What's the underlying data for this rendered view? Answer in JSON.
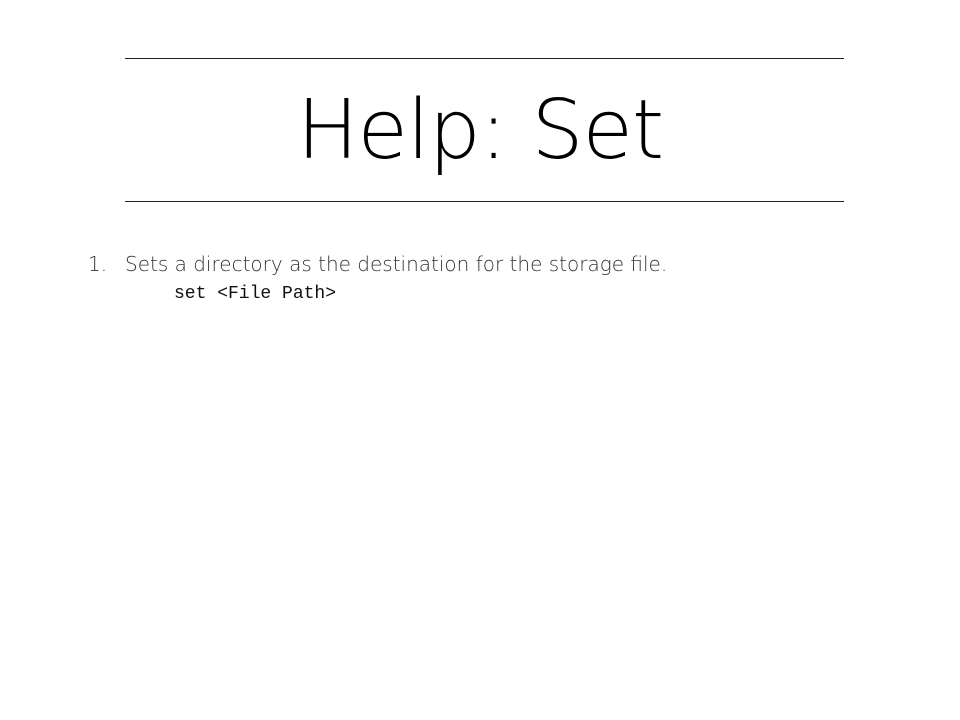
{
  "slide": {
    "title": "Help: Set",
    "items": [
      {
        "number": "1.",
        "text": "Sets a directory as the destination for the storage file.",
        "code": "set <File Path>"
      }
    ]
  }
}
